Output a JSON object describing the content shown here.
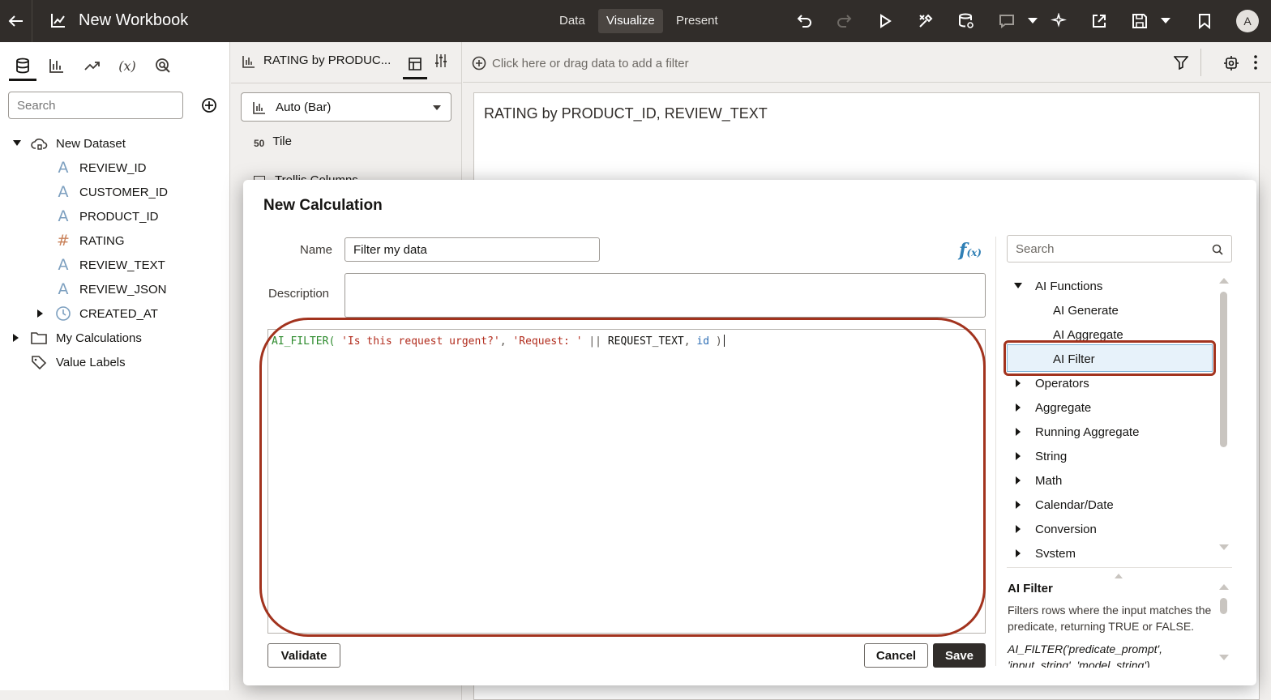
{
  "topbar": {
    "title": "New Workbook",
    "modes": [
      "Data",
      "Visualize",
      "Present"
    ],
    "active_mode": "Visualize",
    "avatar_initial": "A"
  },
  "left_panel": {
    "search_placeholder": "Search",
    "dataset": {
      "name": "New Dataset",
      "columns": [
        {
          "name": "REVIEW_ID",
          "type": "text"
        },
        {
          "name": "CUSTOMER_ID",
          "type": "text"
        },
        {
          "name": "PRODUCT_ID",
          "type": "text"
        },
        {
          "name": "RATING",
          "type": "number"
        },
        {
          "name": "REVIEW_TEXT",
          "type": "text"
        },
        {
          "name": "REVIEW_JSON",
          "type": "text"
        },
        {
          "name": "CREATED_AT",
          "type": "date"
        }
      ]
    },
    "my_calculations": "My Calculations",
    "value_labels": "Value Labels"
  },
  "grammar_panel": {
    "viz_title": "RATING by PRODUC...",
    "chart_type": "Auto (Bar)",
    "tile_label": "Tile",
    "tile_icon_text": "50",
    "partial_label": "Trellis Columns"
  },
  "filter_bar": {
    "placeholder": "Click here or drag data to add a filter"
  },
  "canvas": {
    "viz_title": "RATING by PRODUCT_ID, REVIEW_TEXT"
  },
  "dialog": {
    "title": "New Calculation",
    "name_label": "Name",
    "name_value": "Filter my data",
    "description_label": "Description",
    "description_value": "",
    "expression": {
      "fn": "AI_FILTER(",
      "arg1": "'Is this request urgent?'",
      "sep1": ", ",
      "arg2a": "'Request: '",
      "concat": " || ",
      "arg2b": "REQUEST_TEXT",
      "sep2": ", ",
      "arg3": "id",
      "close": " )"
    },
    "validate_label": "Validate",
    "cancel_label": "Cancel",
    "save_label": "Save",
    "function_search_placeholder": "Search",
    "functions": {
      "ai_functions": "AI Functions",
      "ai_generate": "AI Generate",
      "ai_aggregate": "AI Aggregate",
      "ai_filter": "AI Filter",
      "categories": [
        "Operators",
        "Aggregate",
        "Running Aggregate",
        "String",
        "Math",
        "Calendar/Date",
        "Conversion",
        "System"
      ]
    },
    "description_panel": {
      "title": "AI Filter",
      "text": "Filters rows where the input matches the predicate, returning TRUE or FALSE.",
      "syntax": "AI_FILTER('predicate_prompt', 'input_string', 'model_string')"
    }
  },
  "colors": {
    "topbar": "#312d2a",
    "highlight": "#a2331e",
    "selection": "#e7f2fa"
  }
}
